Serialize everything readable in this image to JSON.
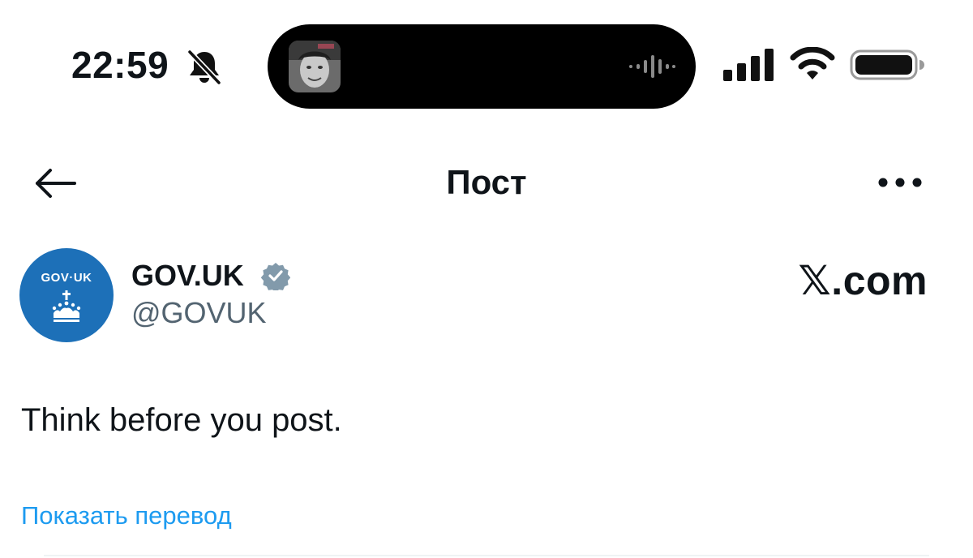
{
  "status_bar": {
    "time": "22:59",
    "icons": [
      "bell-slash-icon",
      "now-playing-art",
      "audio-waveform-icon",
      "cellular-signal-icon",
      "wifi-icon",
      "battery-icon"
    ]
  },
  "header": {
    "title": "Пост",
    "back_icon": "arrow-left-icon",
    "more_icon": "more-horizontal-icon"
  },
  "author": {
    "avatar_text": "GOV·UK",
    "name": "GOV.UK",
    "handle": "@GOVUK",
    "verified": true,
    "avatar_color": "#1d70b8"
  },
  "watermark": "𝕏.com",
  "post": {
    "text": "Think before you post.",
    "translate_label": "Показать перевод"
  },
  "colors": {
    "accent_link": "#1d9bf0",
    "secondary_text": "#536471",
    "verified_badge": "#829aab"
  }
}
